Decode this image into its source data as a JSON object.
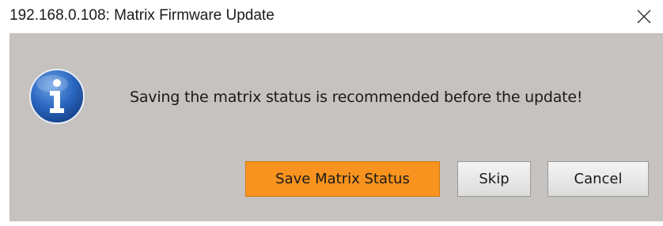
{
  "window": {
    "title": "192.168.0.108: Matrix Firmware Update"
  },
  "dialog": {
    "icon": "info-icon",
    "message": "Saving the matrix status is recommended before the update!"
  },
  "buttons": {
    "save_label": "Save Matrix Status",
    "skip_label": "Skip",
    "cancel_label": "Cancel"
  },
  "colors": {
    "dialog_background": "#c5c2bf",
    "primary_button": "#f7931e",
    "info_icon_blue": "#1f5fb5"
  }
}
